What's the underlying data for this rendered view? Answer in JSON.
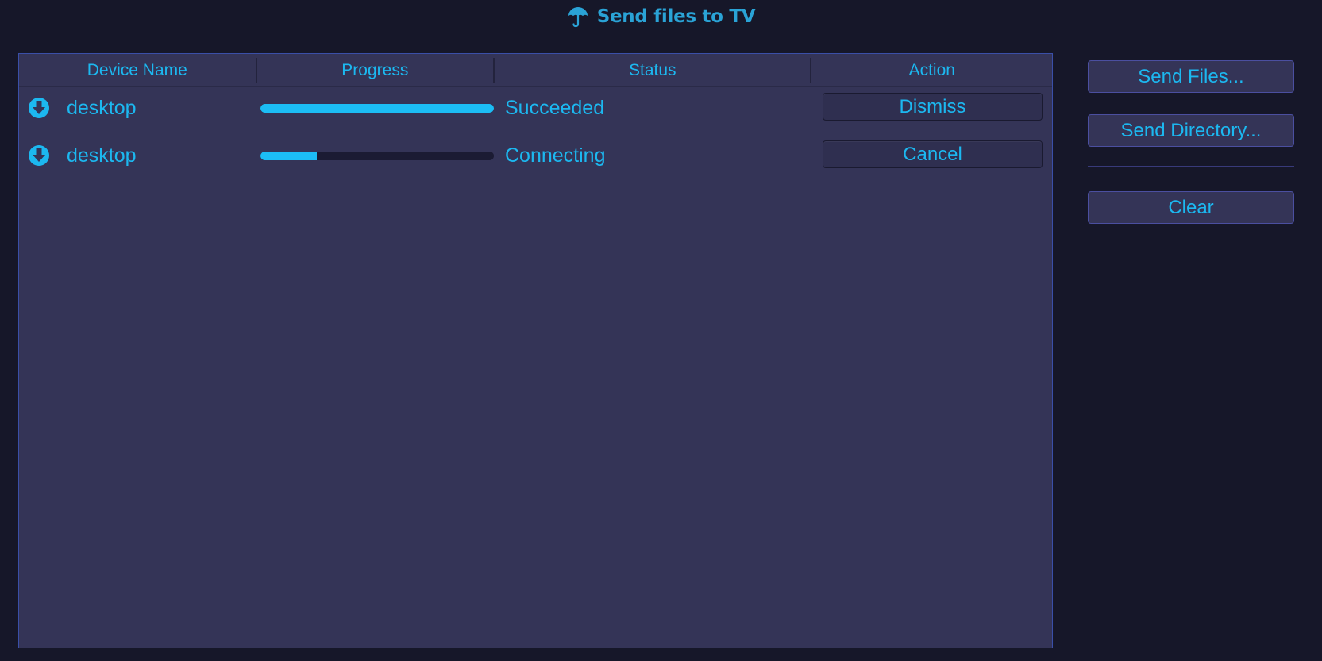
{
  "window": {
    "title": "Send files to TV",
    "title_icon": "umbrella-icon"
  },
  "table": {
    "columns": [
      "Device Name",
      "Progress",
      "Status",
      "Action"
    ],
    "rows": [
      {
        "icon": "download-circle-icon",
        "device": "desktop",
        "progress": 1.0,
        "status": "Succeeded",
        "action": "Dismiss"
      },
      {
        "icon": "download-circle-icon",
        "device": "desktop",
        "progress": 0.24,
        "status": "Connecting",
        "action": "Cancel"
      }
    ]
  },
  "sidebar": {
    "send_files_label": "Send Files...",
    "send_directory_label": "Send Directory...",
    "clear_label": "Clear"
  },
  "colors": {
    "background": "#161729",
    "panel": "#343457",
    "accent": "#1cb8f0",
    "title": "#2aa3d6",
    "track": "#1b1b33"
  }
}
